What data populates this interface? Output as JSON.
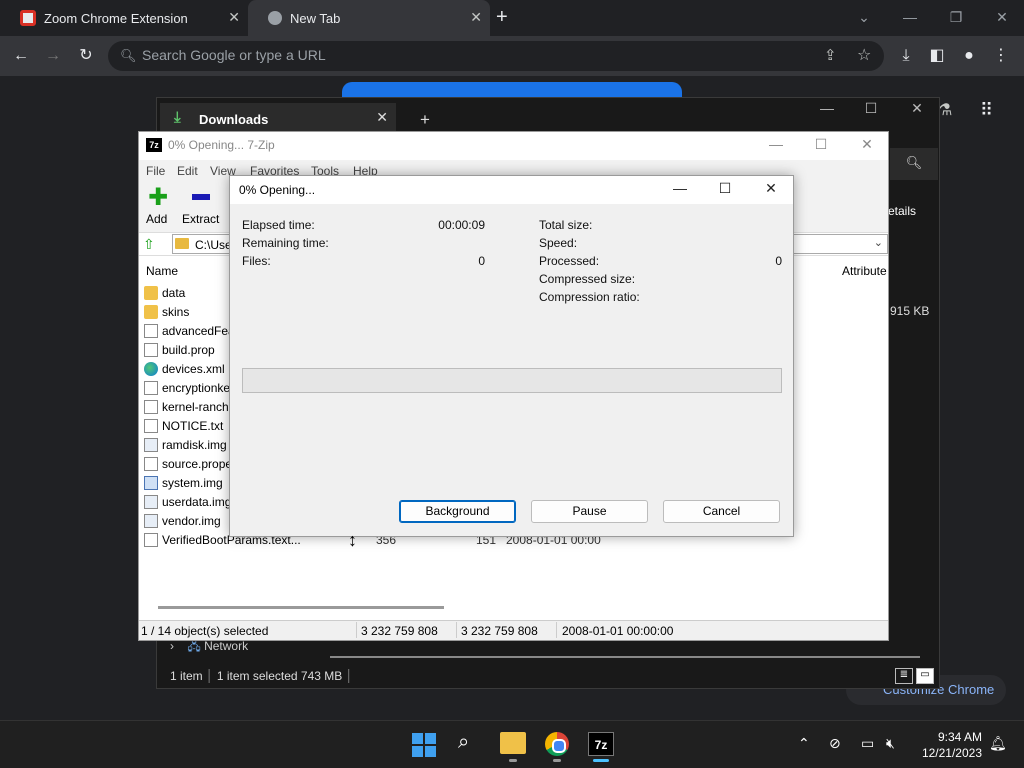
{
  "browser": {
    "tabs": [
      {
        "title": "Zoom Chrome Extension",
        "active": false
      },
      {
        "title": "New Tab",
        "active": true
      }
    ],
    "new_tab_label": "+",
    "omnibox_placeholder": "Search Google or type a URL",
    "customize_label": "Customize Chrome"
  },
  "file_window": {
    "tab_title": "Downloads",
    "details_label": "etails",
    "size_text": "915 KB",
    "network_label": "Network",
    "status": {
      "items": "1 item",
      "selected": "1 item selected  743 MB"
    }
  },
  "sevenzip": {
    "title": "0% Opening... 7-Zip",
    "logo": "7z",
    "menu": [
      "File",
      "Edit",
      "View",
      "Favorites",
      "Tools",
      "Help"
    ],
    "toolbar": {
      "add": "Add",
      "extract": "Extract"
    },
    "path": "C:\\Use",
    "columns": {
      "name": "Name",
      "attributes": "Attribute"
    },
    "files": [
      {
        "name": "data",
        "icon": "folder-icon"
      },
      {
        "name": "skins",
        "icon": "folder-icon"
      },
      {
        "name": "advancedFea",
        "icon": "file-icon"
      },
      {
        "name": "build.prop",
        "icon": "file-icon"
      },
      {
        "name": "devices.xml",
        "icon": "edge-icon"
      },
      {
        "name": "encryptionke",
        "icon": "file-icon"
      },
      {
        "name": "kernel-ranch",
        "icon": "file-icon"
      },
      {
        "name": "NOTICE.txt",
        "icon": "file-icon"
      },
      {
        "name": "ramdisk.img",
        "icon": "image-file-icon"
      },
      {
        "name": "source.prope",
        "icon": "file-icon"
      },
      {
        "name": "system.img",
        "icon": "system-file-icon"
      },
      {
        "name": "userdata.img",
        "icon": "image-file-icon"
      },
      {
        "name": "vendor.img",
        "icon": "image-file-icon"
      },
      {
        "name": "VerifiedBootParams.text...",
        "icon": "file-icon"
      }
    ],
    "last_row": {
      "size": "356",
      "packed": "151",
      "modified": "2008-01-01 00:00"
    },
    "status": {
      "selection": "1 / 14 object(s) selected",
      "size": "3 232 759 808",
      "packed": "3 232 759 808",
      "modified": "2008-01-01 00:00:00"
    }
  },
  "dialog": {
    "title": "0% Opening...",
    "left": [
      {
        "label": "Elapsed time:",
        "value": "00:00:09"
      },
      {
        "label": "Remaining time:",
        "value": ""
      },
      {
        "label": "Files:",
        "value": "0"
      }
    ],
    "right": [
      {
        "label": "Total size:",
        "value": ""
      },
      {
        "label": "Speed:",
        "value": ""
      },
      {
        "label": "Processed:",
        "value": "0"
      },
      {
        "label": "Compressed size:",
        "value": ""
      },
      {
        "label": "Compression ratio:",
        "value": ""
      }
    ],
    "progress_fraction": 0,
    "buttons": {
      "background": "Background",
      "pause": "Pause",
      "cancel": "Cancel"
    }
  },
  "taskbar": {
    "time": "9:34 AM",
    "date": "12/21/2023",
    "zip_label": "7z"
  },
  "colors": {
    "accent": "#0067c0",
    "chrome_dark": "#202124",
    "progress": "#06b025"
  }
}
